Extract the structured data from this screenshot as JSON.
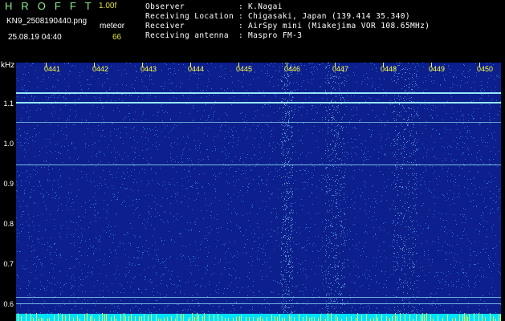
{
  "header": {
    "app_title": "HROFFT",
    "version": "1.00f",
    "filename": "KN9_2508190440.png",
    "meteor_label": "meteor",
    "datetime": "25.08.19 04:40",
    "meteor_count": "66"
  },
  "info": [
    {
      "key": "Observer",
      "sep": ":",
      "value": "K.Nagai"
    },
    {
      "key": "Receiving Location",
      "sep": ":",
      "value": "Chigasaki, Japan (139.414 35.340)"
    },
    {
      "key": "Receiver",
      "sep": ":",
      "value": "AirSpy mini (Miakejima VOR 108.65MHz)"
    },
    {
      "key": "Receiving antenna",
      "sep": ":",
      "value": "Maspro FM-3"
    }
  ],
  "spectrogram": {
    "y_unit": "kHz",
    "y_labels": [
      "1.1",
      "1.0",
      "0.9",
      "0.8",
      "0.7",
      "0.6"
    ],
    "x_labels": [
      "0441",
      "0442",
      "0443",
      "0444",
      "0445",
      "0446",
      "0447",
      "0448",
      "0449",
      "0450"
    ],
    "colors": {
      "background": "#0c1f8c",
      "noise": "#3a8cff",
      "trace": "#9ef2ff",
      "baseline": "#00e0ff",
      "tick": "#ffff40"
    }
  }
}
